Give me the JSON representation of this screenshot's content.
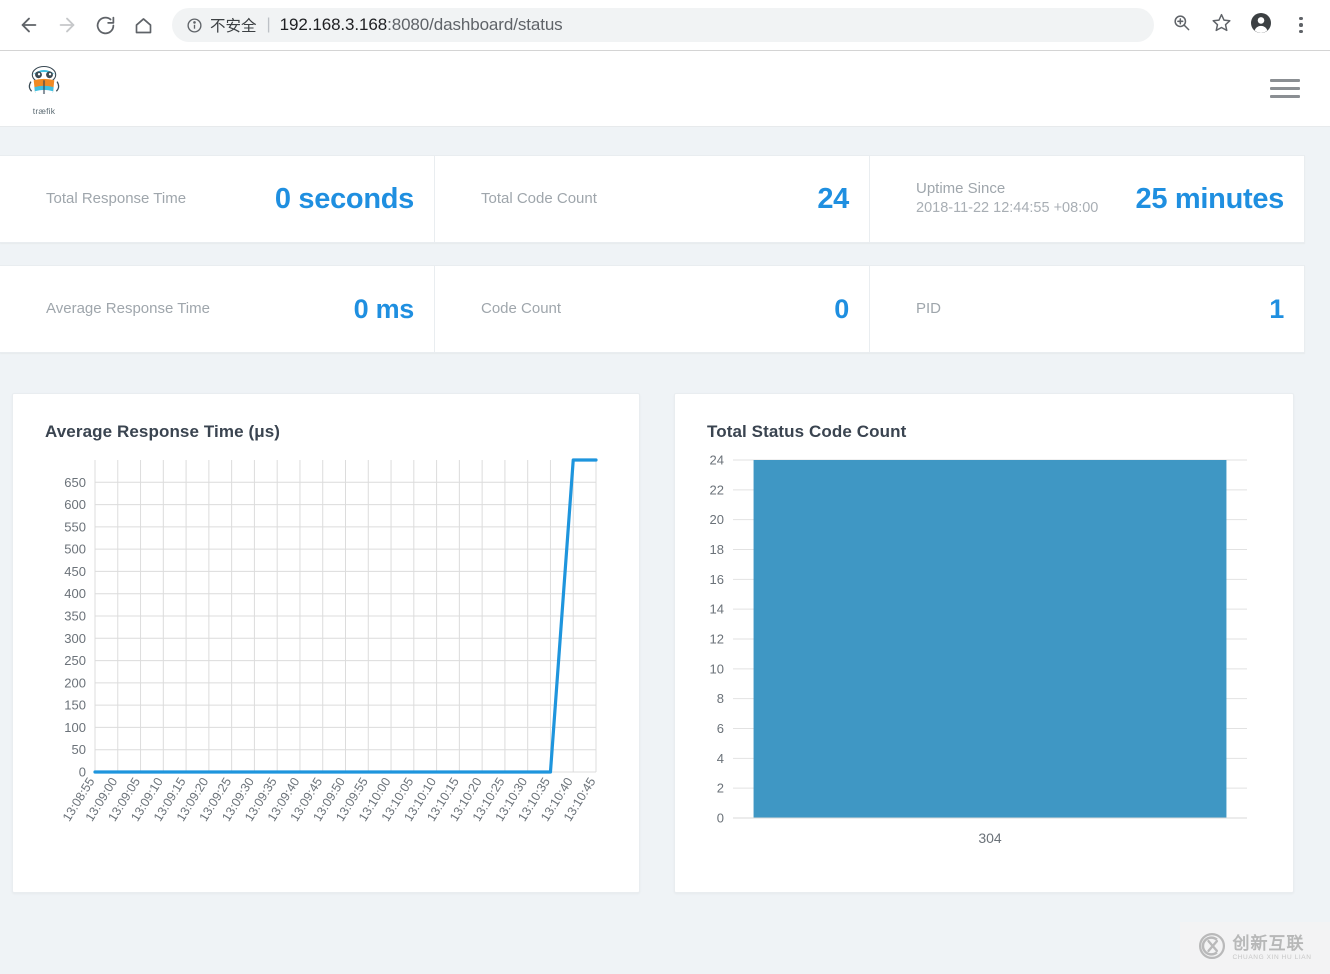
{
  "browser": {
    "back_icon": "arrow-left-icon",
    "forward_icon": "arrow-right-icon",
    "reload_icon": "reload-icon",
    "home_icon": "home-icon",
    "info_icon": "info-circle-icon",
    "security_label": "不安全",
    "divider": "|",
    "url_host": "192.168.3.168",
    "url_path": ":8080/dashboard/status",
    "zoom_icon": "zoom-in-icon",
    "bookmark_icon": "star-icon",
    "profile_icon": "account-avatar-icon",
    "menu_icon": "three-dots-menu-icon"
  },
  "app_header": {
    "logo_text": "træfik",
    "logo_icon": "traefik-logo-icon",
    "menu_icon": "hamburger-menu-icon"
  },
  "stats": {
    "row1": [
      {
        "label": "Total Response Time",
        "sub": "",
        "value": "0 seconds"
      },
      {
        "label": "Total Code Count",
        "sub": "",
        "value": "24"
      },
      {
        "label": "Uptime Since",
        "sub": "2018-11-22 12:44:55 +08:00",
        "value": "25 minutes"
      }
    ],
    "row2": [
      {
        "label": "Average Response Time",
        "sub": "",
        "value": "0 ms"
      },
      {
        "label": "Code Count",
        "sub": "",
        "value": "0"
      },
      {
        "label": "PID",
        "sub": "",
        "value": "1"
      }
    ]
  },
  "colors": {
    "accent_blue": "#1f8fe0",
    "line_blue": "#1e95dd",
    "bar_teal": "#3f97c4",
    "page_bg": "#eff3f6",
    "grid": "#dcdcdc"
  },
  "chart_data": [
    {
      "type": "line",
      "title": "Average Response Time (μs)",
      "xlabel": "",
      "ylabel": "",
      "ylim": [
        0,
        700
      ],
      "yticks": [
        0,
        50,
        100,
        150,
        200,
        250,
        300,
        350,
        400,
        450,
        500,
        550,
        600,
        650
      ],
      "grid": true,
      "legend": "none",
      "categories": [
        "13:08:55",
        "13:09:00",
        "13:09:05",
        "13:09:10",
        "13:09:15",
        "13:09:20",
        "13:09:25",
        "13:09:30",
        "13:09:35",
        "13:09:40",
        "13:09:45",
        "13:09:50",
        "13:09:55",
        "13:10:00",
        "13:10:05",
        "13:10:10",
        "13:10:15",
        "13:10:20",
        "13:10:25",
        "13:10:30",
        "13:10:35",
        "13:10:40",
        "13:10:45"
      ],
      "values": [
        0,
        0,
        0,
        0,
        0,
        0,
        0,
        0,
        0,
        0,
        0,
        0,
        0,
        0,
        0,
        0,
        0,
        0,
        0,
        0,
        0,
        700,
        700
      ]
    },
    {
      "type": "bar",
      "title": "Total Status Code Count",
      "xlabel": "",
      "ylabel": "",
      "ylim": [
        0,
        24
      ],
      "yticks": [
        0,
        2,
        4,
        6,
        8,
        10,
        12,
        14,
        16,
        18,
        20,
        22,
        24
      ],
      "grid": true,
      "legend": "none",
      "categories": [
        "304"
      ],
      "values": [
        24
      ]
    }
  ],
  "watermark": {
    "cn": "创新互联",
    "en": "CHUANG XIN HU LIAN",
    "logo_icon": "cx-logo-icon"
  }
}
